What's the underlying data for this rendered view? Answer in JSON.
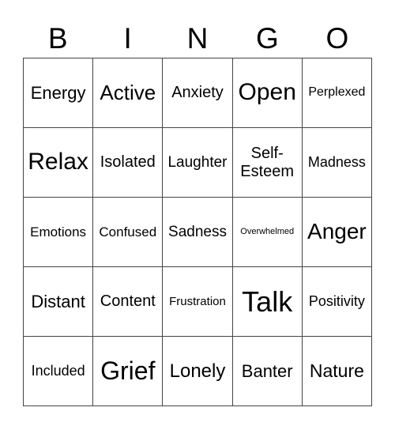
{
  "header": [
    "B",
    "I",
    "N",
    "G",
    "O"
  ],
  "cells": [
    [
      "Energy",
      "Active",
      "Anxiety",
      "Open",
      "Perplexed"
    ],
    [
      "Relax",
      "Isolated",
      "Laughter",
      "Self-\nEsteem",
      "Madness"
    ],
    [
      "Emotions",
      "Confused",
      "Sadness",
      "Overwhelmed",
      "Anger"
    ],
    [
      "Distant",
      "Content",
      "Frustration",
      "Talk",
      "Positivity"
    ],
    [
      "Included",
      "Grief",
      "Lonely",
      "Banter",
      "Nature"
    ]
  ]
}
